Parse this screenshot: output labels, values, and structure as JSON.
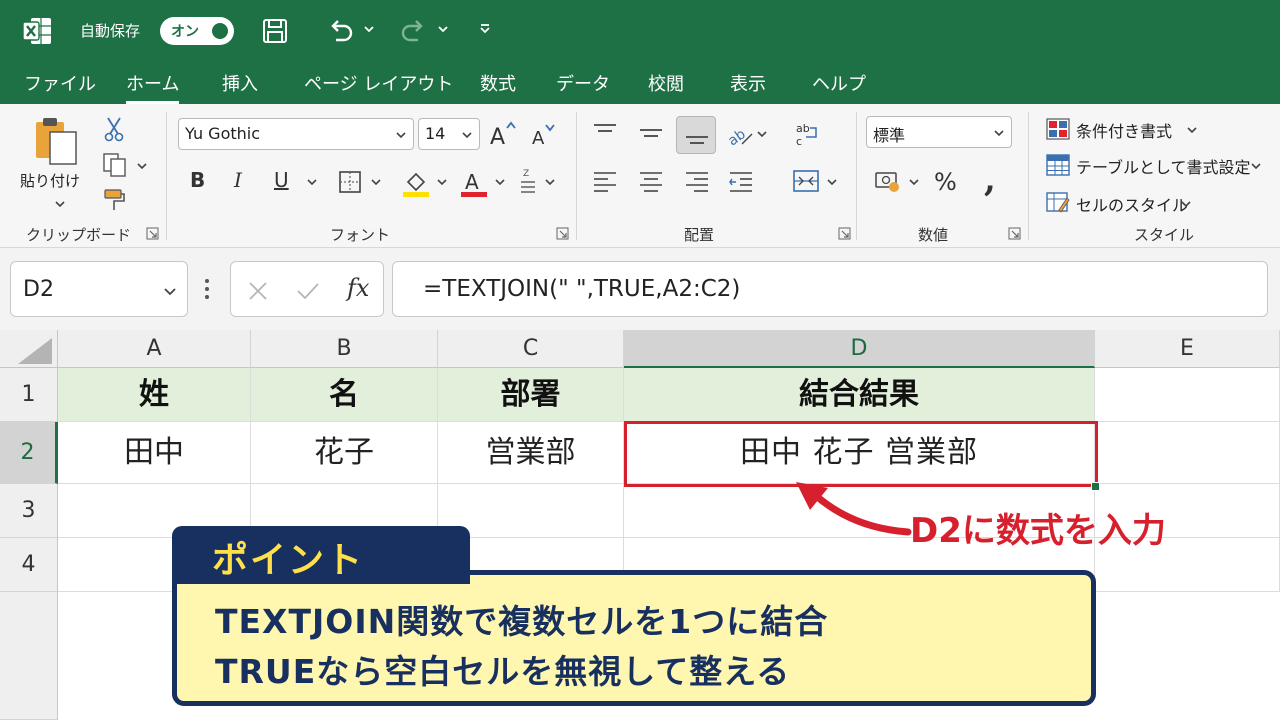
{
  "titlebar": {
    "autosave_label": "自動保存",
    "autosave_toggle": "オン"
  },
  "menu": {
    "tabs": [
      {
        "label": "ファイル"
      },
      {
        "label": "ホーム",
        "active": true
      },
      {
        "label": "挿入"
      },
      {
        "label": "ページ レイアウト"
      },
      {
        "label": "数式"
      },
      {
        "label": "データ"
      },
      {
        "label": "校閲"
      },
      {
        "label": "表示"
      },
      {
        "label": "ヘルプ"
      }
    ]
  },
  "ribbon": {
    "clipboard": {
      "paste_label": "貼り付け",
      "group_label": "クリップボード"
    },
    "font": {
      "font_name": "Yu Gothic",
      "font_size": "14",
      "group_label": "フォント"
    },
    "alignment": {
      "group_label": "配置"
    },
    "number": {
      "format": "標準",
      "group_label": "数値"
    },
    "styles": {
      "conditional": "条件付き書式",
      "table": "テーブルとして書式設定",
      "cell_styles": "セルのスタイル",
      "group_label": "スタイル"
    }
  },
  "formula_bar": {
    "name_box": "D2",
    "formula": "=TEXTJOIN(\" \",TRUE,A2:C2)"
  },
  "sheet": {
    "columns": [
      "A",
      "B",
      "C",
      "D",
      "E"
    ],
    "selected_column": "D",
    "rows": [
      "1",
      "2",
      "3",
      "4"
    ],
    "selected_row": "2",
    "headers": {
      "a": "姓",
      "b": "名",
      "c": "部署",
      "d": "結合結果"
    },
    "row2": {
      "a": "田中",
      "b": "花子",
      "c": "営業部",
      "d": "田中 花子 営業部"
    }
  },
  "callouts": {
    "arrow_label": "D2に数式を入力",
    "point_title": "ポイント",
    "point_line1": "TEXTJOIN関数で複数セルを1つに結合",
    "point_line2": "TRUEなら空白セルを無視して整える"
  },
  "colors": {
    "excel_green": "#1e7145",
    "header_fill": "#e2efda",
    "accent_red": "#d7202e",
    "navy": "#17305f",
    "point_yellow": "#fff7b0"
  }
}
